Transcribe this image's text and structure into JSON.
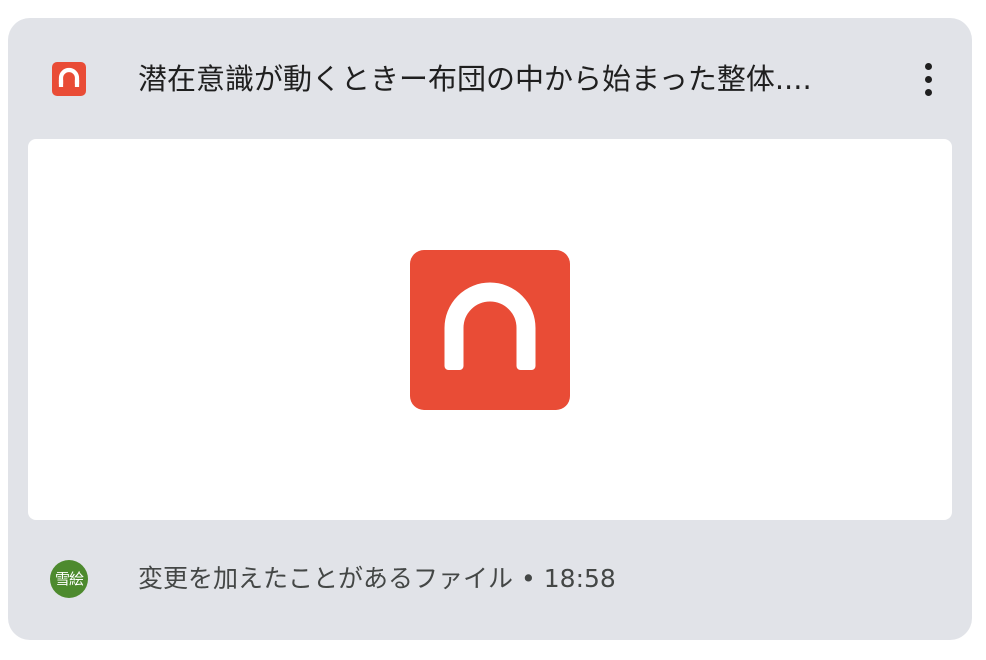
{
  "card": {
    "title": "潜在意識が動くときー布団の中から始まった整体....",
    "file_type_icon": "headphones-icon",
    "more_icon": "more-vert-icon",
    "preview_icon": "headphones-icon",
    "avatar_text": "雪絵",
    "activity_text": "変更を加えたことがあるファイル",
    "separator": "•",
    "time": "18:58"
  },
  "colors": {
    "card_background": "#e1e3e8",
    "audio_icon": "#e94c36",
    "avatar": "#4d8a2e"
  }
}
